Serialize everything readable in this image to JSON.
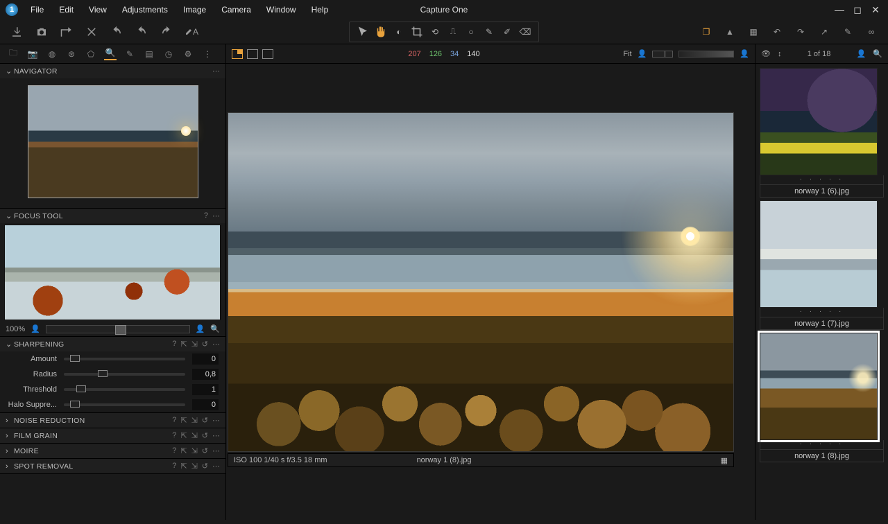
{
  "app": {
    "title": "Capture One"
  },
  "menu": [
    "File",
    "Edit",
    "View",
    "Adjustments",
    "Image",
    "Camera",
    "Window",
    "Help"
  ],
  "rgb": {
    "r": "207",
    "g": "126",
    "b": "34",
    "l": "140"
  },
  "fit_label": "Fit",
  "counter": "1 of 18",
  "left": {
    "navigator": "NAVIGATOR",
    "focus": "FOCUS TOOL",
    "focus_zoom": "100%",
    "sharpening": {
      "title": "SHARPENING",
      "rows": [
        {
          "label": "Amount",
          "value": "0",
          "pos": 5
        },
        {
          "label": "Radius",
          "value": "0,8",
          "pos": 28
        },
        {
          "label": "Threshold",
          "value": "1",
          "pos": 10
        },
        {
          "label": "Halo Suppre...",
          "value": "0",
          "pos": 5
        }
      ]
    },
    "collapsed": [
      "NOISE REDUCTION",
      "FILM GRAIN",
      "MOIRE",
      "SPOT REMOVAL"
    ]
  },
  "status": {
    "exif": "ISO 100 1/40 s f/3.5 18 mm",
    "filename": "norway 1 (8).jpg"
  },
  "thumbs": [
    {
      "name": "norway 1 (6).jpg",
      "cls": "th1",
      "sel": false
    },
    {
      "name": "norway 1 (7).jpg",
      "cls": "th2",
      "sel": false
    },
    {
      "name": "norway 1 (8).jpg",
      "cls": "th3",
      "sel": true
    }
  ]
}
